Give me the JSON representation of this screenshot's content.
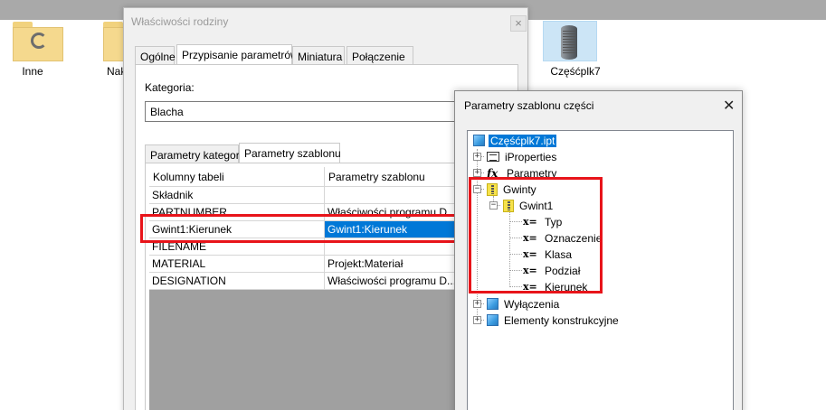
{
  "desktop": {
    "icons": [
      {
        "label": "Inne"
      },
      {
        "label": "Nak"
      },
      {
        "label": "Częśćplk7"
      }
    ]
  },
  "family_dialog": {
    "title": "Właściwości rodziny",
    "close_label": "×",
    "tabs": [
      "Ogólne",
      "Przypisanie parametrów",
      "Miniatura",
      "Połączenie"
    ],
    "category_label": "Kategoria:",
    "category_value": "Blacha",
    "subtabs": [
      "Parametry kategorii",
      "Parametry szablonu"
    ],
    "table": {
      "headers": [
        "Kolumny tabeli",
        "Parametry szablonu"
      ],
      "rows": [
        [
          "Składnik",
          ""
        ],
        [
          "PARTNUMBER",
          "Właściwości programu D..."
        ],
        [
          "Gwint1:Kierunek",
          "Gwint1:Kierunek"
        ],
        [
          "FILENAME",
          ""
        ],
        [
          "MATERIAL",
          "Projekt:Materiał"
        ],
        [
          "DESIGNATION",
          "Właściwości programu D..."
        ]
      ]
    }
  },
  "template_dialog": {
    "title": "Parametry szablonu części",
    "close_label": "✕",
    "tree": {
      "root": "Częśćplk7.ipt",
      "iproperties": "iProperties",
      "parametry": "Parametry",
      "gwinty": "Gwinty",
      "gwint1": "Gwint1",
      "params": [
        "Typ",
        "Oznaczenie",
        "Klasa",
        "Podział",
        "Kierunek"
      ],
      "wylaczenia": "Wyłączenia",
      "elementy": "Elementy konstrukcyjne"
    }
  },
  "colors": {
    "selection": "#0078d7",
    "highlight_box": "#e8141a"
  }
}
